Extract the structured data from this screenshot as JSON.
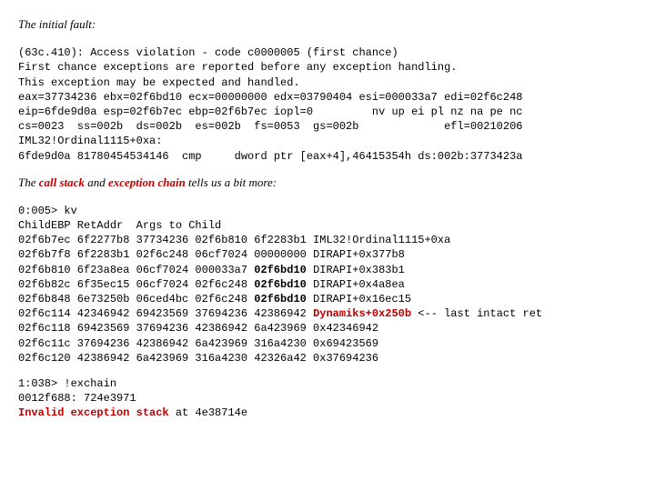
{
  "intro": {
    "line1": "The initial fault:"
  },
  "block1": {
    "l1": "(63c.410): Access violation - code c0000005 (first chance)",
    "l2": "First chance exceptions are reported before any exception handling.",
    "l3": "This exception may be expected and handled.",
    "l4": "eax=37734236 ebx=02f6bd10 ecx=00000000 edx=03790404 esi=000033a7 edi=02f6c248",
    "l5": "eip=6fde9d0a esp=02f6b7ec ebp=02f6b7ec iopl=0         nv up ei pl nz na pe nc",
    "l6": "cs=0023  ss=002b  ds=002b  es=002b  fs=0053  gs=002b             efl=00210206",
    "l7": "IML32!Ordinal1115+0xa:",
    "l8": "6fde9d0a 81780454534146  cmp     dword ptr [eax+4],46415354h ds:002b:3773423a"
  },
  "mid": {
    "pre": "The ",
    "cs": "call stack",
    "and": " and ",
    "ec": "exception chain",
    "post": " tells us a bit more:"
  },
  "block2": {
    "l1": "0:005> kv",
    "l2": "ChildEBP RetAddr  Args to Child",
    "r1a": "02f6b7ec 6f2277b8 37734236 02f6b810 6f2283b1 ",
    "r1b": "IML32!Ordinal1115+0xa",
    "r2a": "02f6b7f8 6f2283b1 02f6c248 06cf7024 00000000 ",
    "r2b": "DIRAPI+0x377b8",
    "r3a": "02f6b810 6f23a8ea 06cf7024 000033a7 ",
    "r3b": "02f6bd10",
    "r3c": " ",
    "r3d": "DIRAPI+0x383b1",
    "r4a": "02f6b82c 6f35ec15 06cf7024 02f6c248 ",
    "r4b": "02f6bd10",
    "r4c": " ",
    "r4d": "DIRAPI+0x4a8ea",
    "r5a": "02f6b848 6e73250b 06ced4bc 02f6c248 ",
    "r5b": "02f6bd10",
    "r5c": " ",
    "r5d": "DIRAPI+0x16ec15",
    "r6a": "02f6c114 42346942 69423569 37694236 42386942 ",
    "r6b": "Dynamiks+0x250b",
    "r6c": " <-- last intact ret",
    "r7": "02f6c118 69423569 37694236 42386942 6a423969 0x42346942",
    "r8": "02f6c11c 37694236 42386942 6a423969 316a4230 0x69423569",
    "r9": "02f6c120 42386942 6a423969 316a4230 42326a42 0x37694236"
  },
  "block3": {
    "l1": "1:038> !exchain",
    "l2": "0012f688: 724e3971",
    "l3a": "Invalid exception stack",
    "l3b": " at 4e38714e"
  }
}
